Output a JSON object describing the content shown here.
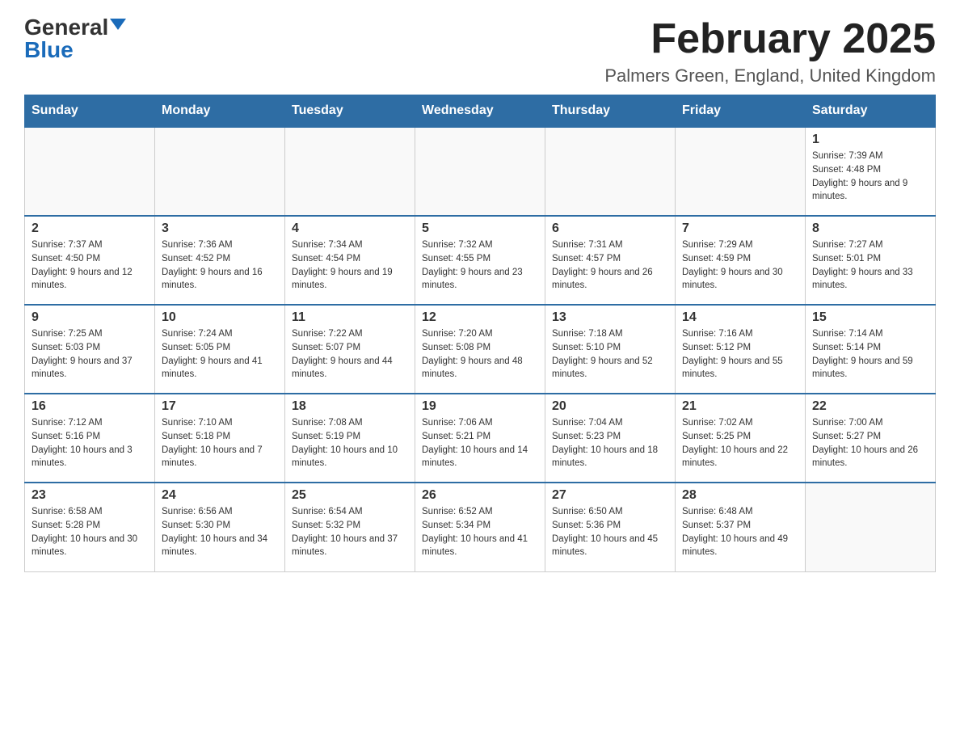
{
  "header": {
    "logo_general": "General",
    "logo_blue": "Blue",
    "month_title": "February 2025",
    "location": "Palmers Green, England, United Kingdom"
  },
  "days_of_week": [
    "Sunday",
    "Monday",
    "Tuesday",
    "Wednesday",
    "Thursday",
    "Friday",
    "Saturday"
  ],
  "weeks": [
    [
      {
        "day": "",
        "info": ""
      },
      {
        "day": "",
        "info": ""
      },
      {
        "day": "",
        "info": ""
      },
      {
        "day": "",
        "info": ""
      },
      {
        "day": "",
        "info": ""
      },
      {
        "day": "",
        "info": ""
      },
      {
        "day": "1",
        "info": "Sunrise: 7:39 AM\nSunset: 4:48 PM\nDaylight: 9 hours and 9 minutes."
      }
    ],
    [
      {
        "day": "2",
        "info": "Sunrise: 7:37 AM\nSunset: 4:50 PM\nDaylight: 9 hours and 12 minutes."
      },
      {
        "day": "3",
        "info": "Sunrise: 7:36 AM\nSunset: 4:52 PM\nDaylight: 9 hours and 16 minutes."
      },
      {
        "day": "4",
        "info": "Sunrise: 7:34 AM\nSunset: 4:54 PM\nDaylight: 9 hours and 19 minutes."
      },
      {
        "day": "5",
        "info": "Sunrise: 7:32 AM\nSunset: 4:55 PM\nDaylight: 9 hours and 23 minutes."
      },
      {
        "day": "6",
        "info": "Sunrise: 7:31 AM\nSunset: 4:57 PM\nDaylight: 9 hours and 26 minutes."
      },
      {
        "day": "7",
        "info": "Sunrise: 7:29 AM\nSunset: 4:59 PM\nDaylight: 9 hours and 30 minutes."
      },
      {
        "day": "8",
        "info": "Sunrise: 7:27 AM\nSunset: 5:01 PM\nDaylight: 9 hours and 33 minutes."
      }
    ],
    [
      {
        "day": "9",
        "info": "Sunrise: 7:25 AM\nSunset: 5:03 PM\nDaylight: 9 hours and 37 minutes."
      },
      {
        "day": "10",
        "info": "Sunrise: 7:24 AM\nSunset: 5:05 PM\nDaylight: 9 hours and 41 minutes."
      },
      {
        "day": "11",
        "info": "Sunrise: 7:22 AM\nSunset: 5:07 PM\nDaylight: 9 hours and 44 minutes."
      },
      {
        "day": "12",
        "info": "Sunrise: 7:20 AM\nSunset: 5:08 PM\nDaylight: 9 hours and 48 minutes."
      },
      {
        "day": "13",
        "info": "Sunrise: 7:18 AM\nSunset: 5:10 PM\nDaylight: 9 hours and 52 minutes."
      },
      {
        "day": "14",
        "info": "Sunrise: 7:16 AM\nSunset: 5:12 PM\nDaylight: 9 hours and 55 minutes."
      },
      {
        "day": "15",
        "info": "Sunrise: 7:14 AM\nSunset: 5:14 PM\nDaylight: 9 hours and 59 minutes."
      }
    ],
    [
      {
        "day": "16",
        "info": "Sunrise: 7:12 AM\nSunset: 5:16 PM\nDaylight: 10 hours and 3 minutes."
      },
      {
        "day": "17",
        "info": "Sunrise: 7:10 AM\nSunset: 5:18 PM\nDaylight: 10 hours and 7 minutes."
      },
      {
        "day": "18",
        "info": "Sunrise: 7:08 AM\nSunset: 5:19 PM\nDaylight: 10 hours and 10 minutes."
      },
      {
        "day": "19",
        "info": "Sunrise: 7:06 AM\nSunset: 5:21 PM\nDaylight: 10 hours and 14 minutes."
      },
      {
        "day": "20",
        "info": "Sunrise: 7:04 AM\nSunset: 5:23 PM\nDaylight: 10 hours and 18 minutes."
      },
      {
        "day": "21",
        "info": "Sunrise: 7:02 AM\nSunset: 5:25 PM\nDaylight: 10 hours and 22 minutes."
      },
      {
        "day": "22",
        "info": "Sunrise: 7:00 AM\nSunset: 5:27 PM\nDaylight: 10 hours and 26 minutes."
      }
    ],
    [
      {
        "day": "23",
        "info": "Sunrise: 6:58 AM\nSunset: 5:28 PM\nDaylight: 10 hours and 30 minutes."
      },
      {
        "day": "24",
        "info": "Sunrise: 6:56 AM\nSunset: 5:30 PM\nDaylight: 10 hours and 34 minutes."
      },
      {
        "day": "25",
        "info": "Sunrise: 6:54 AM\nSunset: 5:32 PM\nDaylight: 10 hours and 37 minutes."
      },
      {
        "day": "26",
        "info": "Sunrise: 6:52 AM\nSunset: 5:34 PM\nDaylight: 10 hours and 41 minutes."
      },
      {
        "day": "27",
        "info": "Sunrise: 6:50 AM\nSunset: 5:36 PM\nDaylight: 10 hours and 45 minutes."
      },
      {
        "day": "28",
        "info": "Sunrise: 6:48 AM\nSunset: 5:37 PM\nDaylight: 10 hours and 49 minutes."
      },
      {
        "day": "",
        "info": ""
      }
    ]
  ]
}
